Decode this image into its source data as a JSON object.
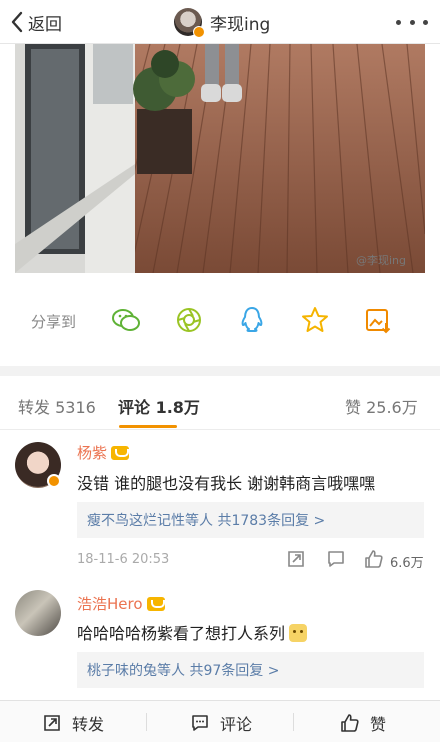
{
  "header": {
    "back_label": "返回",
    "title": "李现ing"
  },
  "photo": {
    "watermark": "@李现ing"
  },
  "share": {
    "label": "分享到",
    "icons": [
      "wechat-icon",
      "moments-icon",
      "qq-icon",
      "qzone-icon",
      "save-image-icon"
    ]
  },
  "tabs": {
    "repost": "转发 5316",
    "comments": "评论 1.8万",
    "likes": "赞 25.6万"
  },
  "comments": [
    {
      "name": "杨紫",
      "text": "没错 谁的腿也没有我长 谢谢韩商言哦嘿嘿",
      "reply_summary": "瘦不鸟这烂记性等人  共1783条回复 >",
      "time": "18-11-6 20:53",
      "likes": "6.6万"
    },
    {
      "name": "浩浩Hero",
      "text": "哈哈哈哈杨紫看了想打人系列",
      "reply_summary": "桃子味的兔等人  共97条回复 >"
    }
  ],
  "bottom_bar": {
    "repost": "转发",
    "comment": "评论",
    "like": "赞"
  },
  "colors": {
    "accent": "#f29200",
    "username": "#eb7350",
    "link": "#5b7da8"
  }
}
